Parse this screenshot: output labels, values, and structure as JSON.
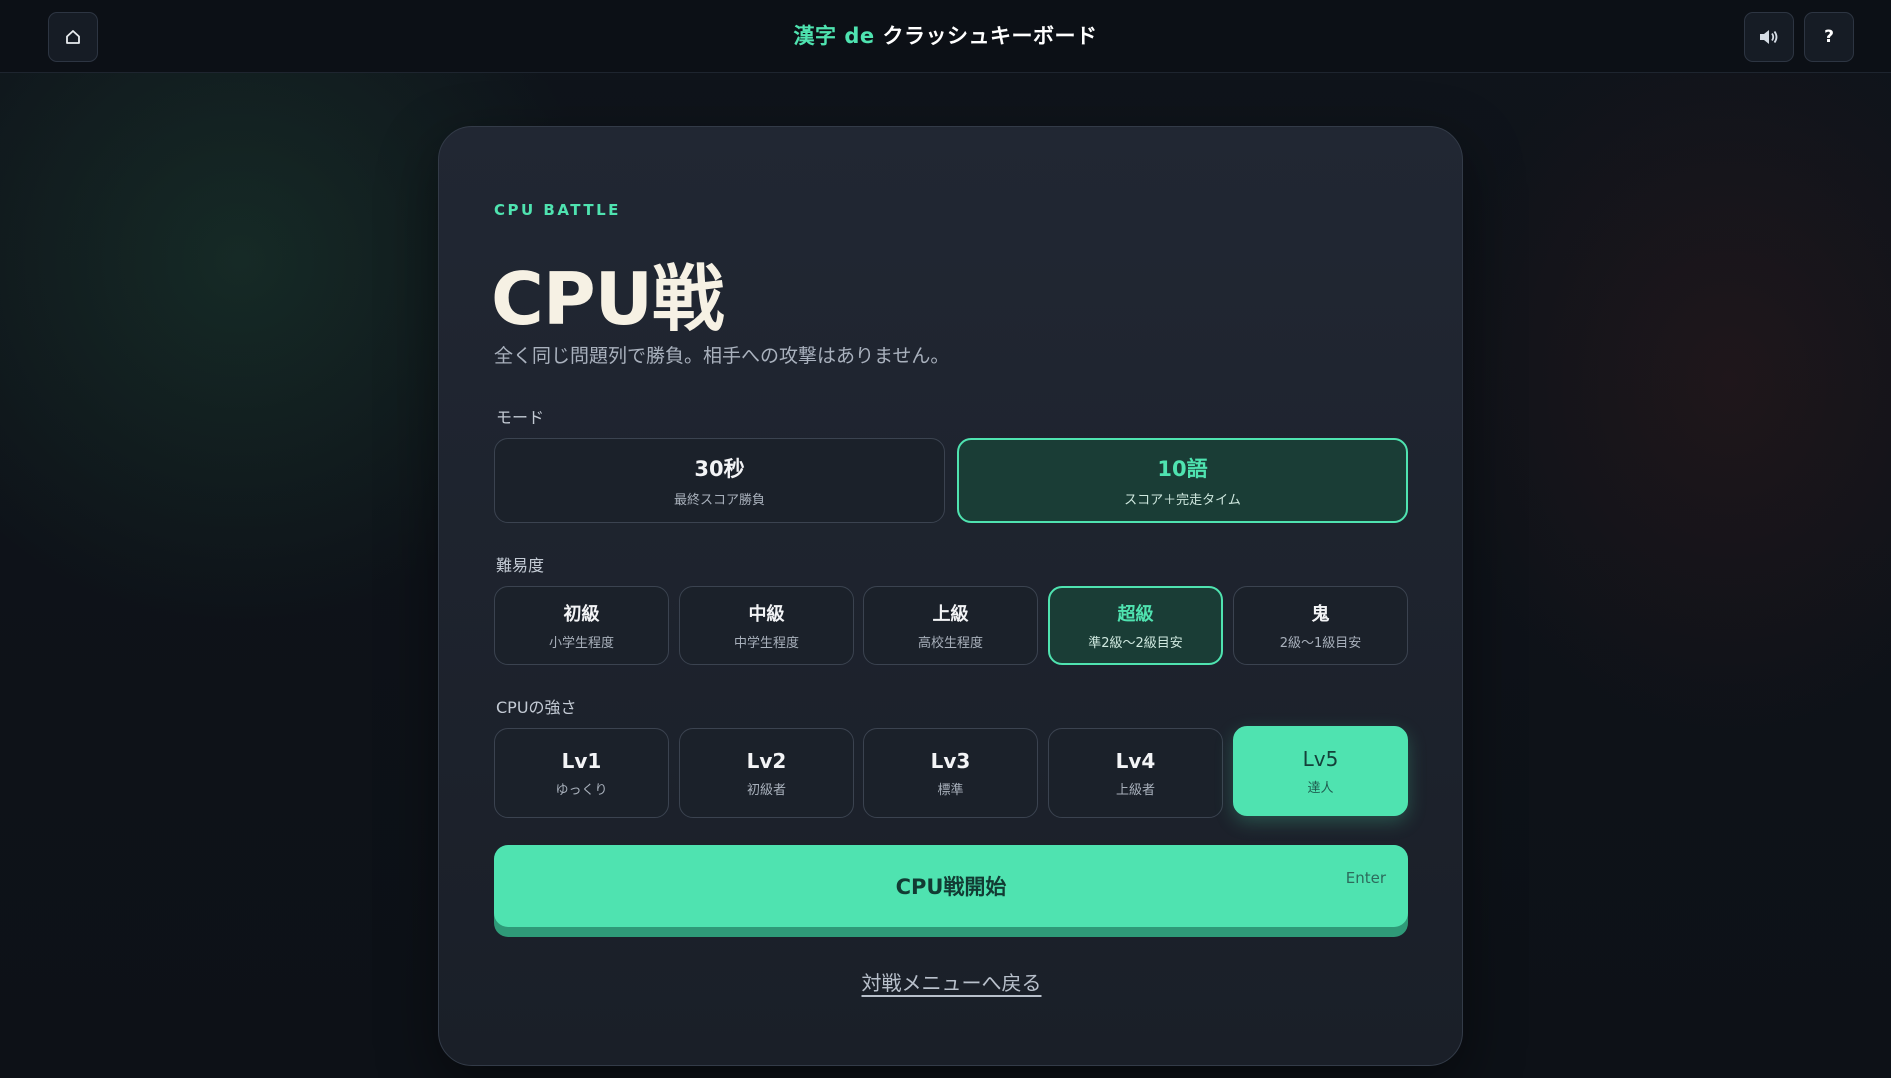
{
  "header": {
    "title_accent": "漢字 de",
    "title_rest": "クラッシュキーボード",
    "home_icon": "home-icon",
    "sound_icon": "speaker-icon",
    "help_label": "?"
  },
  "card": {
    "eyebrow": "CPU BATTLE",
    "title": "CPU戦",
    "subtitle": "全く同じ問題列で勝負。相手への攻撃はありません。"
  },
  "mode": {
    "label": "モード",
    "options": [
      {
        "main": "30秒",
        "sub": "最終スコア勝負",
        "selected": false
      },
      {
        "main": "10語",
        "sub": "スコア＋完走タイム",
        "selected": true
      }
    ]
  },
  "difficulty": {
    "label": "難易度",
    "options": [
      {
        "main": "初級",
        "sub": "小学生程度",
        "selected": false
      },
      {
        "main": "中級",
        "sub": "中学生程度",
        "selected": false
      },
      {
        "main": "上級",
        "sub": "高校生程度",
        "selected": false
      },
      {
        "main": "超級",
        "sub": "準2級〜2級目安",
        "selected": true
      },
      {
        "main": "鬼",
        "sub": "2級〜1級目安",
        "selected": false
      }
    ]
  },
  "cpu_strength": {
    "label": "CPUの強さ",
    "options": [
      {
        "main": "Lv1",
        "sub": "ゆっくり",
        "selected": false
      },
      {
        "main": "Lv2",
        "sub": "初級者",
        "selected": false
      },
      {
        "main": "Lv3",
        "sub": "標準",
        "selected": false
      },
      {
        "main": "Lv4",
        "sub": "上級者",
        "selected": false
      },
      {
        "main": "Lv5",
        "sub": "達人",
        "selected": true
      }
    ]
  },
  "start": {
    "label": "CPU戦開始",
    "shortcut": "Enter"
  },
  "back_link": "対戦メニューへ戻る",
  "colors": {
    "accent": "#4fe3b0",
    "background": "#0d1117",
    "card": "#1e2430"
  }
}
